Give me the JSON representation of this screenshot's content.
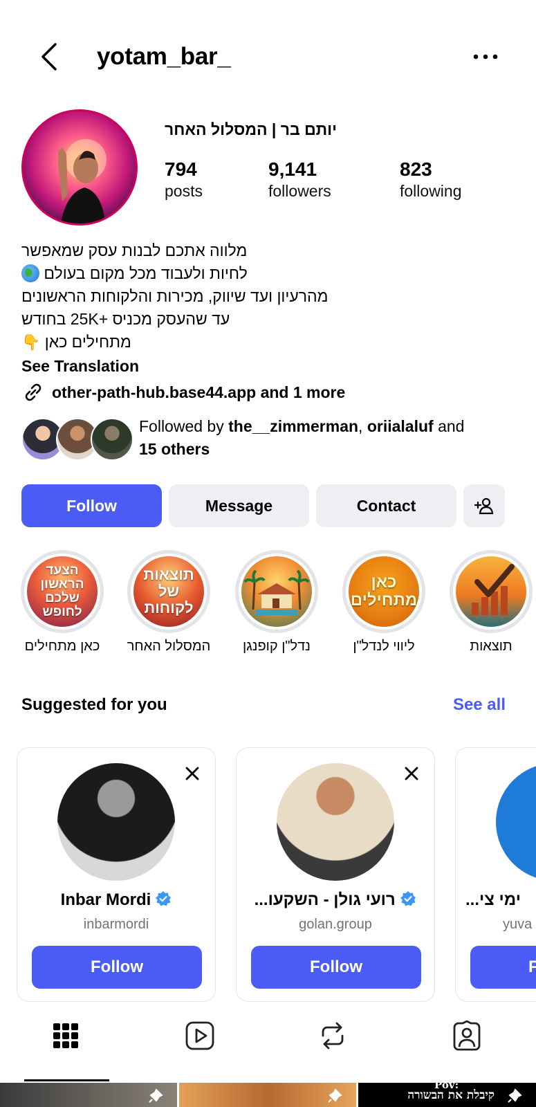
{
  "header": {
    "username": "yotam_bar_",
    "back_icon": "chevron-left-icon",
    "more_icon": "more-horizontal-icon"
  },
  "profile": {
    "display_name": "יותם בר | המסלול האחר",
    "stats": {
      "posts": {
        "value": "794",
        "label": "posts"
      },
      "followers": {
        "value": "9,141",
        "label": "followers"
      },
      "following": {
        "value": "823",
        "label": "following"
      }
    }
  },
  "bio": {
    "lines": [
      "מלווה אתכם לבנות עסק שמאפשר",
      "לחיות ולעבוד מכל מקום בעולם",
      "מהרעיון ועד שיווק, מכירות והלקוחות הראשונים",
      "עד שהעסק מכניס +25K בחודש",
      "מתחילים כאן"
    ],
    "see_translation": "See Translation",
    "link_text": "other-path-hub.base44.app and 1 more"
  },
  "followed_by": {
    "prefix": "Followed by ",
    "user1": "the__zimmerman",
    "sep": ", ",
    "user2": "oriialaluf",
    "and": " and",
    "others": "15 others"
  },
  "actions": {
    "follow": "Follow",
    "message": "Message",
    "contact": "Contact",
    "add_user_icon": "add-user-icon"
  },
  "highlights": [
    {
      "label": "כאן מתחילים",
      "cover_text": "הצעד הראשון שלכם לחופש"
    },
    {
      "label": "המסלול האחר",
      "cover_text": "תוצאות של לקוחות"
    },
    {
      "label": "נדל\"ן קופנגן",
      "cover_text": ""
    },
    {
      "label": "ליווי לנדל\"ן",
      "cover_text": "כאן מתחילים"
    },
    {
      "label": "תוצאות",
      "cover_text": ""
    }
  ],
  "suggested": {
    "title": "Suggested for you",
    "see_all": "See all",
    "cards": [
      {
        "name": "Inbar Mordi",
        "handle": "inbarmordi",
        "verified": true,
        "follow": "Follow"
      },
      {
        "name": "רועי גולן - השקעו...",
        "handle": "golan.group",
        "verified": true,
        "follow": "Follow"
      },
      {
        "name": "ימי צי...",
        "handle": "yuva",
        "verified": false,
        "follow": "F"
      }
    ]
  },
  "tabs": {
    "grid": "grid-icon",
    "reels": "reels-icon",
    "reposts": "repost-icon",
    "tagged": "tagged-icon"
  },
  "grid_preview": {
    "third_caption": "קיבלת את הבשורה",
    "third_pov": "Pov:"
  },
  "colors": {
    "accent": "#4a5cf5",
    "button_gray": "#eeeff2"
  }
}
